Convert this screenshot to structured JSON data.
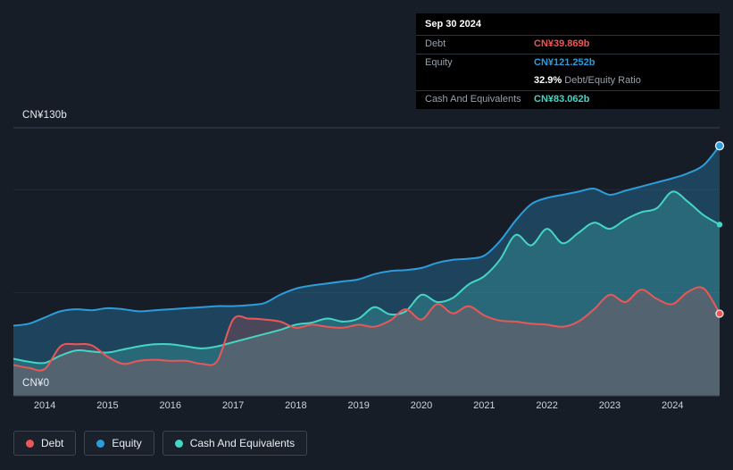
{
  "tooltip": {
    "date": "Sep 30 2024",
    "debt_label": "Debt",
    "debt_value": "CN¥39.869b",
    "equity_label": "Equity",
    "equity_value": "CN¥121.252b",
    "ratio_value": "32.9%",
    "ratio_label": "Debt/Equity Ratio",
    "cash_label": "Cash And Equivalents",
    "cash_value": "CN¥83.062b"
  },
  "axis": {
    "y_max_label": "CN¥130b",
    "y_min_label": "CN¥0"
  },
  "colors": {
    "debt": "#eb5757",
    "equity": "#2d9cdb",
    "cash": "#45d5c5",
    "background": "#171d27",
    "gridline": "#3a4350"
  },
  "legend": [
    {
      "id": "debt",
      "label": "Debt",
      "color": "#eb5757"
    },
    {
      "id": "equity",
      "label": "Equity",
      "color": "#2d9cdb"
    },
    {
      "id": "cash",
      "label": "Cash And Equivalents",
      "color": "#45d5c5"
    }
  ],
  "chart_data": {
    "type": "area",
    "x_unit": "year",
    "ylim": [
      0,
      130
    ],
    "y_gridlines": [
      50,
      100
    ],
    "y_axis_labels": {
      "max": "CN¥130b",
      "min": "CN¥0"
    },
    "x_ticks": [
      "2014",
      "2015",
      "2016",
      "2017",
      "2018",
      "2019",
      "2020",
      "2021",
      "2022",
      "2023",
      "2024"
    ],
    "legend_position": "bottom-left",
    "x": [
      2013.5,
      2013.75,
      2014,
      2014.25,
      2014.5,
      2014.75,
      2015,
      2015.25,
      2015.5,
      2015.75,
      2016,
      2016.25,
      2016.5,
      2016.75,
      2017,
      2017.25,
      2017.5,
      2017.75,
      2018,
      2018.25,
      2018.5,
      2018.75,
      2019,
      2019.25,
      2019.5,
      2019.75,
      2020,
      2020.25,
      2020.5,
      2020.75,
      2021,
      2021.25,
      2021.5,
      2021.75,
      2022,
      2022.25,
      2022.5,
      2022.75,
      2023,
      2023.25,
      2023.5,
      2023.75,
      2024,
      2024.25,
      2024.5,
      2024.75
    ],
    "series": [
      {
        "id": "equity",
        "name": "Equity",
        "color": "#2d9cdb",
        "values": [
          34,
          35,
          38,
          41,
          42,
          41.5,
          42.5,
          42,
          41,
          41.5,
          42,
          42.5,
          43,
          43.5,
          43.5,
          44,
          45,
          49,
          52,
          53.5,
          54.5,
          55.5,
          56.5,
          59,
          60.5,
          61,
          62,
          64.5,
          66,
          66.5,
          68,
          75,
          85,
          93,
          96,
          97.5,
          99,
          100.5,
          97.5,
          99.5,
          101.5,
          103.5,
          105.5,
          108,
          112,
          121.252
        ]
      },
      {
        "id": "cash",
        "name": "Cash And Equivalents",
        "color": "#45d5c5",
        "values": [
          18,
          16.5,
          16,
          19.5,
          22,
          21.5,
          21,
          22.5,
          24,
          25,
          25,
          24,
          23,
          24,
          26,
          28,
          30,
          32,
          34.5,
          35.5,
          37.5,
          36,
          37.5,
          43,
          39.5,
          41,
          49,
          45.5,
          47.5,
          54,
          58,
          66,
          78,
          73,
          81,
          74,
          79,
          84,
          81,
          85.5,
          89,
          91,
          99,
          94,
          87.5,
          83.062
        ]
      },
      {
        "id": "debt",
        "name": "Debt",
        "color": "#eb5757",
        "values": [
          15,
          13.5,
          13,
          24,
          25,
          24.5,
          19,
          15.5,
          17,
          17.5,
          17,
          17,
          15.5,
          17,
          37,
          37.5,
          37,
          36,
          33,
          34.5,
          33.5,
          33,
          34.5,
          33.5,
          36.5,
          42,
          37,
          44.5,
          40,
          43.5,
          39,
          36.5,
          36,
          35,
          34.5,
          33.5,
          36,
          42,
          49,
          45.5,
          51.5,
          47,
          44.5,
          50.5,
          52,
          39.869
        ]
      }
    ],
    "last_point": {
      "date": "Sep 30 2024",
      "debt": 39.869,
      "equity": 121.252,
      "cash": 83.062,
      "debt_equity_ratio_pct": 32.9
    }
  }
}
